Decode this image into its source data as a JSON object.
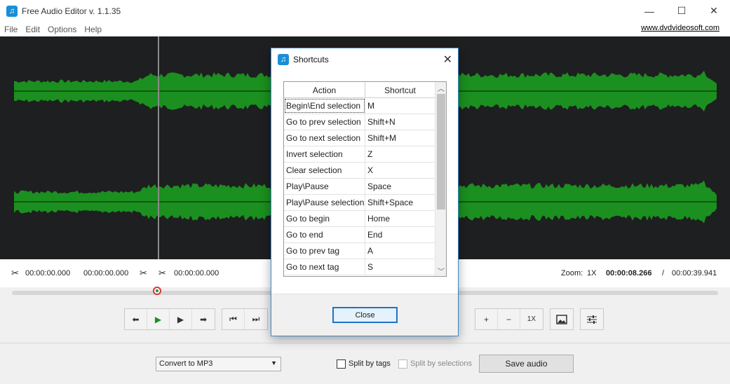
{
  "app": {
    "title": "Free Audio Editor v. 1.1.35",
    "icon": "music-note-icon"
  },
  "window_controls": {
    "minimize": "—",
    "maximize": "☐",
    "close": "✕"
  },
  "menu": {
    "items": [
      "File",
      "Edit",
      "Options",
      "Help"
    ],
    "site_link": "www.dvdvideosoft.com"
  },
  "waveform": {
    "accent_color": "#1b8f1f",
    "background": "#1e1f20"
  },
  "timebar": {
    "sel_start": "00:00:00.000",
    "sel_end": "00:00:00.000",
    "cut_time": "00:00:00.000",
    "zoom_label": "Zoom:",
    "zoom_value": "1X",
    "current_time": "00:00:08.266",
    "separator": "/",
    "total_time": "00:00:39.941"
  },
  "seek": {
    "position_fraction": 0.206
  },
  "controls": {
    "prev": "⬅",
    "play": "▶",
    "play_selection": "▶",
    "next": "➡",
    "skip_back": "⏮",
    "skip_forward": "⏭",
    "zoom_in": "+",
    "zoom_out": "−",
    "zoom_reset": "1X",
    "image_icon": "image-icon",
    "settings_icon": "sliders-icon"
  },
  "bottom": {
    "format_select": "Convert to MP3",
    "split_tags_label": "Split by tags",
    "split_selections_label": "Split by selections",
    "save_button": "Save audio"
  },
  "dialog": {
    "title": "Shortcuts",
    "close_button": "Close",
    "columns": [
      "Action",
      "Shortcut"
    ],
    "rows": [
      {
        "action": "Begin\\End selection",
        "shortcut": "M"
      },
      {
        "action": "Go to prev selection",
        "shortcut": "Shift+N"
      },
      {
        "action": "Go to next selection",
        "shortcut": "Shift+M"
      },
      {
        "action": "Invert selection",
        "shortcut": "Z"
      },
      {
        "action": "Clear selection",
        "shortcut": "X"
      },
      {
        "action": "Play\\Pause",
        "shortcut": "Space"
      },
      {
        "action": "Play\\Pause selection",
        "shortcut": "Shift+Space"
      },
      {
        "action": "Go to begin",
        "shortcut": "Home"
      },
      {
        "action": "Go to end",
        "shortcut": "End"
      },
      {
        "action": "Go to prev tag",
        "shortcut": "A"
      },
      {
        "action": "Go to next tag",
        "shortcut": "S"
      }
    ]
  }
}
